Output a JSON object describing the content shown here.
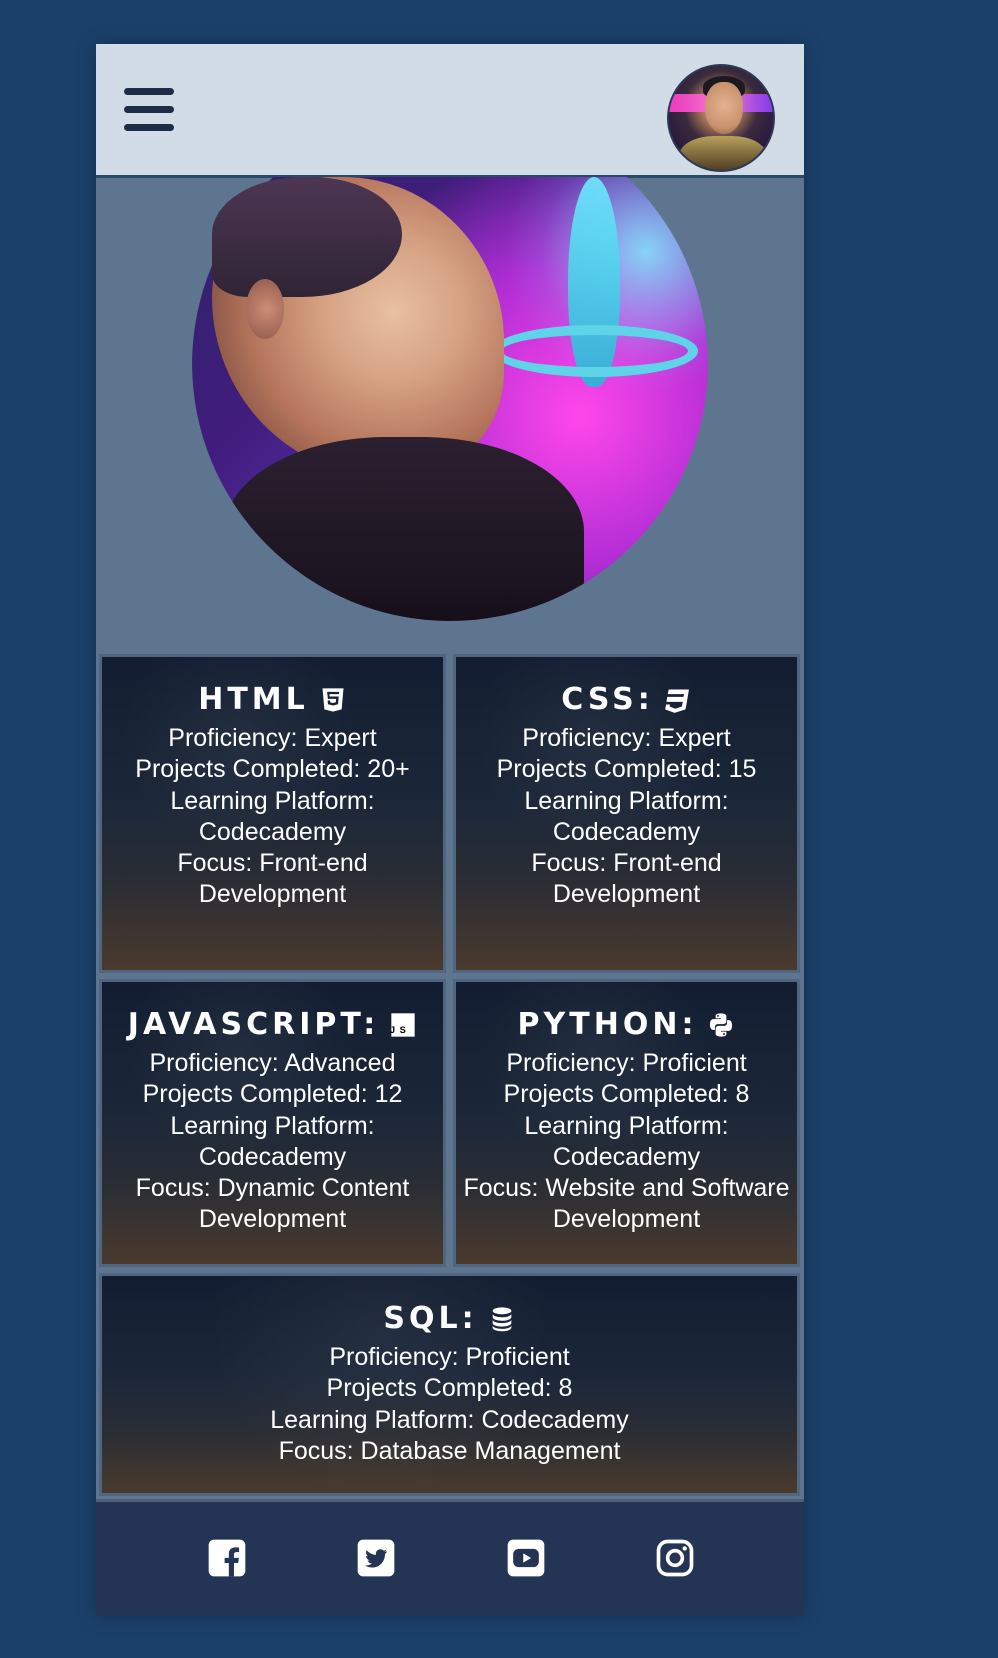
{
  "header": {
    "menu_icon": "hamburger-icon",
    "avatar_icon": "profile-avatar"
  },
  "hero": {
    "image_icon": "hero-portrait"
  },
  "skills": [
    {
      "title": "HTML",
      "icon": "html5-icon",
      "lines": [
        "Proficiency: Expert",
        "Projects Completed: 20+",
        "Learning Platform: Codecademy",
        "Focus: Front-end Development"
      ]
    },
    {
      "title": "CSS:",
      "icon": "css3-icon",
      "lines": [
        "Proficiency: Expert",
        "Projects Completed: 15",
        "Learning Platform: Codecademy",
        "Focus: Front-end Development"
      ]
    },
    {
      "title": "JAVASCRIPT:",
      "icon": "js-icon",
      "lines": [
        "Proficiency: Advanced",
        "Projects Completed: 12",
        "Learning Platform: Codecademy",
        "Focus: Dynamic Content Development"
      ]
    },
    {
      "title": "PYTHON:",
      "icon": "python-icon",
      "lines": [
        "Proficiency: Proficient",
        "Projects Completed: 8",
        "Learning Platform: Codecademy",
        "Focus: Website and Software Development"
      ]
    },
    {
      "title": "SQL:",
      "icon": "database-icon",
      "lines": [
        "Proficiency: Proficient",
        "Projects Completed: 8",
        "Learning Platform: Codecademy",
        "Focus: Database Management"
      ]
    }
  ],
  "footer": {
    "social_icons": [
      "facebook-icon",
      "twitter-icon",
      "youtube-icon",
      "instagram-icon"
    ]
  },
  "colors": {
    "background": "#1b406a",
    "header_bg": "#d1dce6",
    "panel_bg": "#5e7590",
    "footer_bg": "#243455",
    "text": "#ffffff"
  }
}
